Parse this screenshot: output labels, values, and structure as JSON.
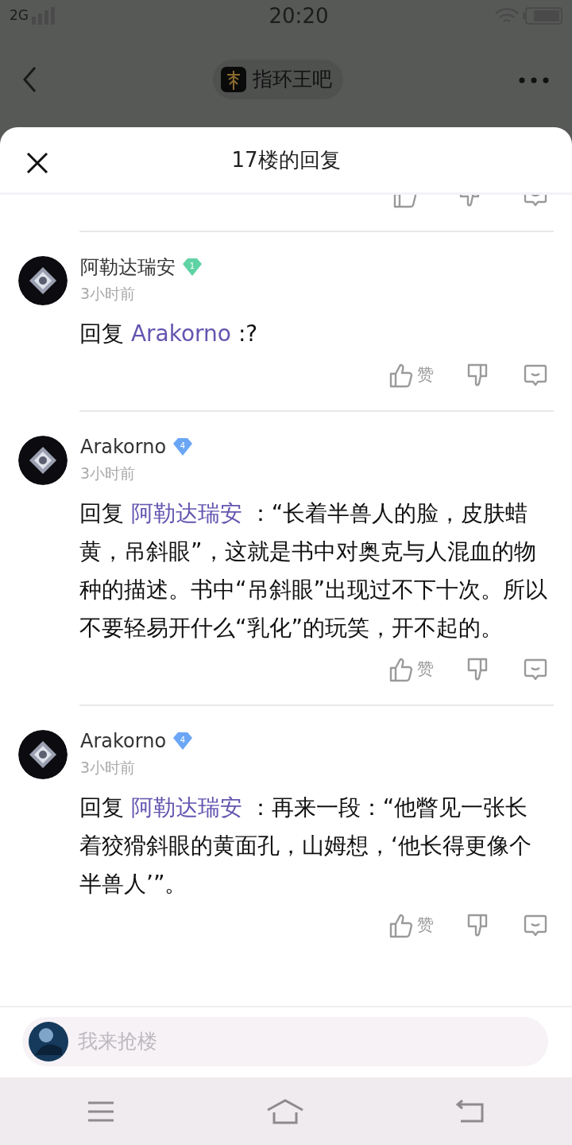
{
  "status_bar": {
    "network": "2G",
    "time": "20:20"
  },
  "header": {
    "forum_name": "指环王吧"
  },
  "sheet": {
    "title": "17楼的回复"
  },
  "comments": [
    {
      "author": "阿勒达瑞安",
      "level": "1",
      "color": "#5fd3a4",
      "time": "3小时前",
      "reply_prefix": "回复",
      "reply_to": "Arakorno",
      "body": " :?",
      "like_label": "赞"
    },
    {
      "author": "Arakorno",
      "level": "4",
      "color": "#6aa6f5",
      "time": "3小时前",
      "reply_prefix": "回复",
      "reply_to": "阿勒达瑞安",
      "body": " ：“长着半兽人的脸，皮肤蜡黄，吊斜眼”，这就是书中对奥克与人混血的物种的描述。书中“吊斜眼”出现过不下十次。所以不要轻易开什么“乳化”的玩笑，开不起的。",
      "like_label": "赞"
    },
    {
      "author": "Arakorno",
      "level": "4",
      "color": "#6aa6f5",
      "time": "3小时前",
      "reply_prefix": "回复",
      "reply_to": "阿勒达瑞安",
      "body": "：再来一段：“他瞥见一张长着狡猾斜眼的黄面孔，山姆想，‘他长得更像个半兽人’”。",
      "like_label": "赞"
    }
  ],
  "composer": {
    "placeholder": "我来抢楼"
  }
}
